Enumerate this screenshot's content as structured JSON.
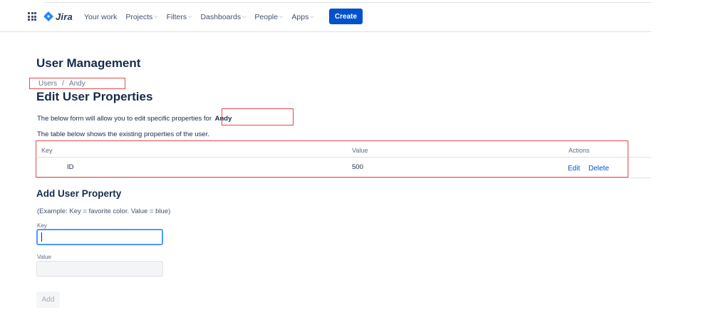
{
  "nav": {
    "logo": "Jira",
    "items": [
      {
        "label": "Your work",
        "dropdown": false
      },
      {
        "label": "Projects",
        "dropdown": true
      },
      {
        "label": "Filters",
        "dropdown": true
      },
      {
        "label": "Dashboards",
        "dropdown": true
      },
      {
        "label": "People",
        "dropdown": true
      },
      {
        "label": "Apps",
        "dropdown": true
      }
    ],
    "create_label": "Create"
  },
  "page": {
    "title": "User Management",
    "breadcrumb": {
      "root": "Users",
      "separator": "/",
      "current": "Andy"
    },
    "section_title": "Edit User Properties",
    "intro_text": "The below form will allow you to edit specific properties for",
    "user_name": "Andy",
    "table_note": "The table below shows the existing properties of the user."
  },
  "table": {
    "headers": {
      "key": "Key",
      "value": "Value",
      "actions": "Actions"
    },
    "rows": [
      {
        "key": "ID",
        "value": "500",
        "edit": "Edit",
        "delete": "Delete"
      }
    ]
  },
  "add_property": {
    "title": "Add User Property",
    "example": "(Example: Key = favorite color. Value = blue)",
    "key_label": "Key",
    "key_value": "",
    "value_label": "Value",
    "value_value": "",
    "add_label": "Add"
  },
  "colors": {
    "primary": "#0052cc",
    "highlight_box": "#e5484d",
    "focus_border": "#4c9aff"
  }
}
